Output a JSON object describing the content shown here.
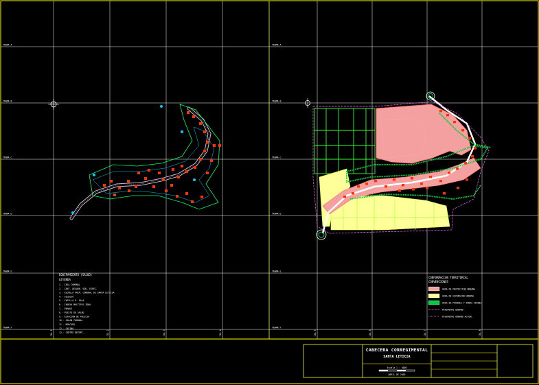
{
  "drawing": {
    "background": "#000000",
    "frame_color": "#ffff00",
    "grid_color": "#ffffff"
  },
  "grid": {
    "row_labels": [
      "TRAMA A",
      "TRAMA B",
      "TRAMA C",
      "TRAMA D",
      "TRAMA E",
      "TRAMA F"
    ],
    "col_labels": [
      "COL 1",
      "COL 2",
      "COL 3",
      "COL 4",
      "COL 5",
      "COL 6",
      "COL 7",
      "COL 8"
    ]
  },
  "left_plan": {
    "legend_title": "EQUIPAMIENTO (SALUD)",
    "legend_subtitle": "LEYENDA",
    "legend_items": [
      "1.- CASA COMUNAL",
      "2.- CENT. DESARR. EDU. ESPEC.",
      "3.- ESCUELA PRIM. COMUNAL DE SANTA LETICIA",
      "4.- COLEGIO",
      "5.- CAPILLA E. SALA",
      "6.- CANCHA MULTIPLE ZONA",
      "7.- PARQUE",
      "8.- PUESTO DE SALUD",
      "9.- ESTACION DE POLICIA",
      "10.- SALON COMUNAL",
      "11.- MERCADO",
      "12.- CASINO",
      "13.- CENTRO DEPORT."
    ]
  },
  "right_plan": {
    "legend_title": "CONFORMACION TERRITORIAL",
    "legend_subtitle": "CONVENCIONES",
    "legend_items": [
      {
        "label": "AREA DE PROTECCION URBANA",
        "color": "#f4a0a0"
      },
      {
        "label": "AREA DE EXPANSION URBANA",
        "color": "#ffff99"
      },
      {
        "label": "AREA DE PARQUES Y ZONAS VERDES",
        "color": "#00cc44"
      },
      {
        "label": "PERIMETRO URBANO",
        "color": "#ff66ff"
      },
      {
        "label": "PERIMETRO URBANO ACTUAL",
        "color": "#ff66ff"
      }
    ]
  },
  "title_block": {
    "title": "CABECERA CORREGIMENTAL",
    "subtitle": "SANTA LETICIA",
    "scale": "Escala 1 : 5000",
    "date": "ABRIL DE 2003"
  }
}
